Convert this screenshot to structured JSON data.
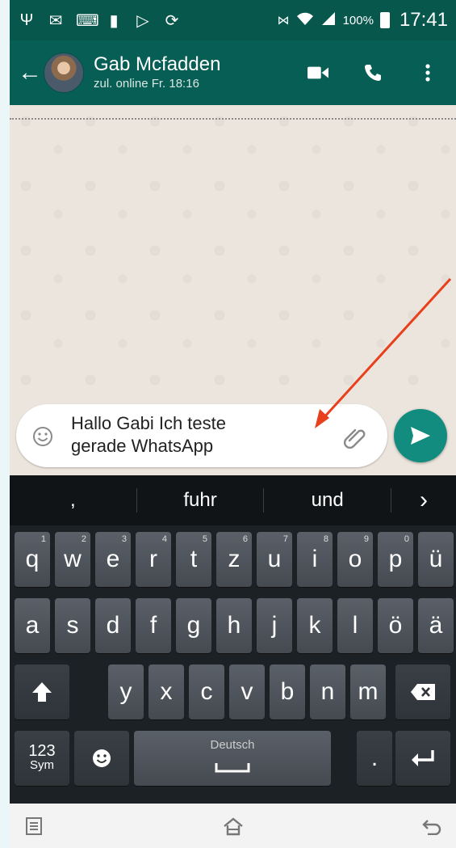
{
  "status_bar": {
    "battery_percent": "100%",
    "time": "17:41",
    "icons": [
      "usb-icon",
      "mail-icon",
      "keyboard-icon",
      "sim-icon",
      "play-store-icon",
      "sync-icon",
      "nfc-icon",
      "wifi-icon",
      "signal-icon",
      "battery-icon"
    ]
  },
  "header": {
    "contact_name": "Gab Mcfadden",
    "contact_status": "zul. online Fr. 18:16",
    "icons": [
      "back-arrow-icon",
      "video-call-icon",
      "phone-icon",
      "more-vert-icon"
    ]
  },
  "composer": {
    "message_line1": "Hallo Gabi Ich teste",
    "message_line2": "gerade WhatsApp"
  },
  "keyboard": {
    "suggestions": [
      ",",
      "fuhr",
      "und"
    ],
    "row1": [
      {
        "label": "q",
        "hint": "1"
      },
      {
        "label": "w",
        "hint": "2"
      },
      {
        "label": "e",
        "hint": "3"
      },
      {
        "label": "r",
        "hint": "4"
      },
      {
        "label": "t",
        "hint": "5"
      },
      {
        "label": "z",
        "hint": "6"
      },
      {
        "label": "u",
        "hint": "7"
      },
      {
        "label": "i",
        "hint": "8"
      },
      {
        "label": "o",
        "hint": "9"
      },
      {
        "label": "p",
        "hint": "0"
      },
      {
        "label": "ü",
        "hint": ""
      }
    ],
    "row2": [
      "a",
      "s",
      "d",
      "f",
      "g",
      "h",
      "j",
      "k",
      "l",
      "ö",
      "ä"
    ],
    "row3": [
      "y",
      "x",
      "c",
      "v",
      "b",
      "n",
      "m"
    ],
    "sym_top": "123",
    "sym_bottom": "Sym",
    "space_label": "Deutsch",
    "period": "."
  },
  "colors": {
    "status_bar": "#08574d",
    "app_bar": "#075e54",
    "send_button": "#128c7e",
    "annotation_arrow": "#e8401c"
  }
}
